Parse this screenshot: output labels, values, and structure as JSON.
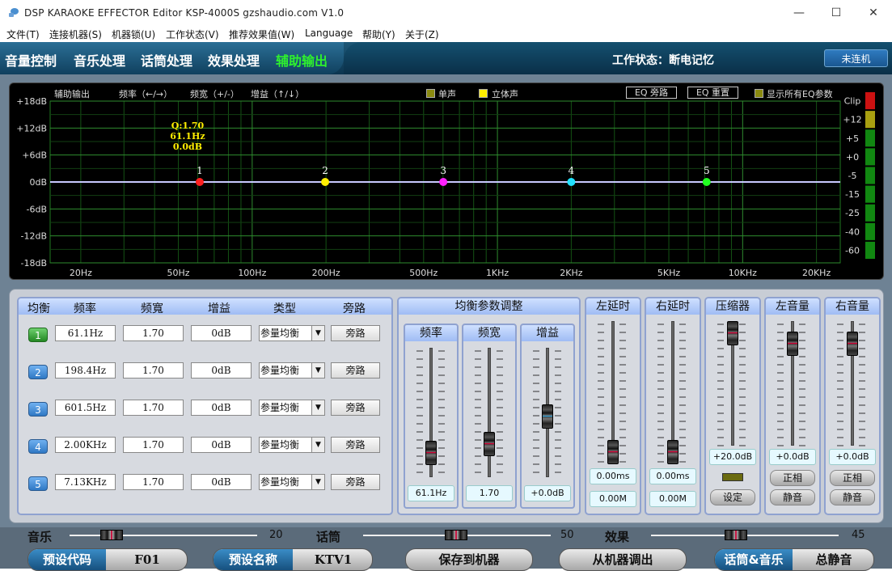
{
  "window": {
    "title": "DSP KARAOKE EFFECTOR Editor KSP-4000S    gzshaudio.com    V1.0",
    "minimize": "—",
    "maximize": "☐",
    "close": "✕"
  },
  "menu": [
    "文件(T)",
    "连接机器(S)",
    "机器锁(U)",
    "工作状态(V)",
    "推荐效果值(W)",
    "Language",
    "帮助(Y)",
    "关于(Z)"
  ],
  "tabs": [
    "音量控制",
    "音乐处理",
    "话筒处理",
    "效果处理",
    "辅助输出"
  ],
  "active_tab": 4,
  "work_status": "工作状态：断电记忆",
  "connect_label": "未连机",
  "eq": {
    "header": {
      "section": "辅助输出",
      "freq": "频率（←/→）",
      "bw": "频宽（+/-）",
      "gain": "增益（↑/↓）"
    },
    "mono_label": "单声",
    "stereo_label": "立体声",
    "bypass_btn": "EQ 旁路",
    "reset_btn": "EQ 重置",
    "show_all_label": "显示所有EQ参数",
    "y_ticks": [
      "+18dB",
      "+12dB",
      "+6dB",
      "0dB",
      "-6dB",
      "-12dB",
      "-18dB"
    ],
    "x_ticks": [
      {
        "label": "20Hz",
        "f": 20
      },
      {
        "label": "50Hz",
        "f": 50
      },
      {
        "label": "100Hz",
        "f": 100
      },
      {
        "label": "200Hz",
        "f": 200
      },
      {
        "label": "500Hz",
        "f": 500
      },
      {
        "label": "1KHz",
        "f": 1000
      },
      {
        "label": "2KHz",
        "f": 2000
      },
      {
        "label": "5KHz",
        "f": 5000
      },
      {
        "label": "10KHz",
        "f": 10000
      },
      {
        "label": "20KHz",
        "f": 20000
      }
    ],
    "points": [
      {
        "n": "1",
        "f": 61.1,
        "color": "#ff2020"
      },
      {
        "n": "2",
        "f": 198.4,
        "color": "#ffee00"
      },
      {
        "n": "3",
        "f": 601.5,
        "color": "#ff20ff"
      },
      {
        "n": "4",
        "f": 2000,
        "color": "#20e0ff"
      },
      {
        "n": "5",
        "f": 7130,
        "color": "#20ff20"
      }
    ],
    "tooltip": [
      "Q:1.70",
      "61.1Hz",
      "0.0dB"
    ],
    "meter_labels": [
      "Clip",
      "+12",
      "+5",
      "+0",
      "-5",
      "-15",
      "-25",
      "-40",
      "-60"
    ]
  },
  "peq": {
    "headers": [
      "均衡",
      "频率",
      "频寬",
      "增益",
      "类型",
      "旁路"
    ],
    "bands": [
      {
        "n": "1",
        "freq": "61.1Hz",
        "bw": "1.70",
        "gain": "0dB",
        "type": "参量均衡",
        "bypass": "旁路"
      },
      {
        "n": "2",
        "freq": "198.4Hz",
        "bw": "1.70",
        "gain": "0dB",
        "type": "参量均衡",
        "bypass": "旁路"
      },
      {
        "n": "3",
        "freq": "601.5Hz",
        "bw": "1.70",
        "gain": "0dB",
        "type": "参量均衡",
        "bypass": "旁路"
      },
      {
        "n": "4",
        "freq": "2.00KHz",
        "bw": "1.70",
        "gain": "0dB",
        "type": "参量均衡",
        "bypass": "旁路"
      },
      {
        "n": "5",
        "freq": "7.13KHz",
        "bw": "1.70",
        "gain": "0dB",
        "type": "参量均衡",
        "bypass": "旁路"
      }
    ]
  },
  "adjust": {
    "title": "均衡参数调整",
    "freq": {
      "label": "频率",
      "value": "61.1Hz"
    },
    "bw": {
      "label": "频宽",
      "value": "1.70"
    },
    "gain": {
      "label": "增益",
      "value": "+0.0dB"
    }
  },
  "delay_left": {
    "title": "左延时",
    "ms": "0.00ms",
    "m": "0.00M"
  },
  "delay_right": {
    "title": "右延时",
    "ms": "0.00ms",
    "m": "0.00M"
  },
  "compressor": {
    "title": "压缩器",
    "value": "+20.0dB",
    "set": "设定"
  },
  "vol_left": {
    "title": "左音量",
    "value": "+0.0dB",
    "phase": "正相",
    "mute": "静音"
  },
  "vol_right": {
    "title": "右音量",
    "value": "+0.0dB",
    "phase": "正相",
    "mute": "静音"
  },
  "mix": [
    {
      "label": "音乐",
      "value": "20"
    },
    {
      "label": "话筒",
      "value": "50"
    },
    {
      "label": "效果",
      "value": "45"
    }
  ],
  "bottom_buttons": {
    "preset_code_label": "预设代码",
    "preset_code": "F01",
    "preset_name_label": "预设名称",
    "preset_name": "KTV1",
    "save": "保存到机器",
    "load": "从机器调出",
    "mic_music": "话筒&音乐",
    "mute_all": "总静音"
  }
}
